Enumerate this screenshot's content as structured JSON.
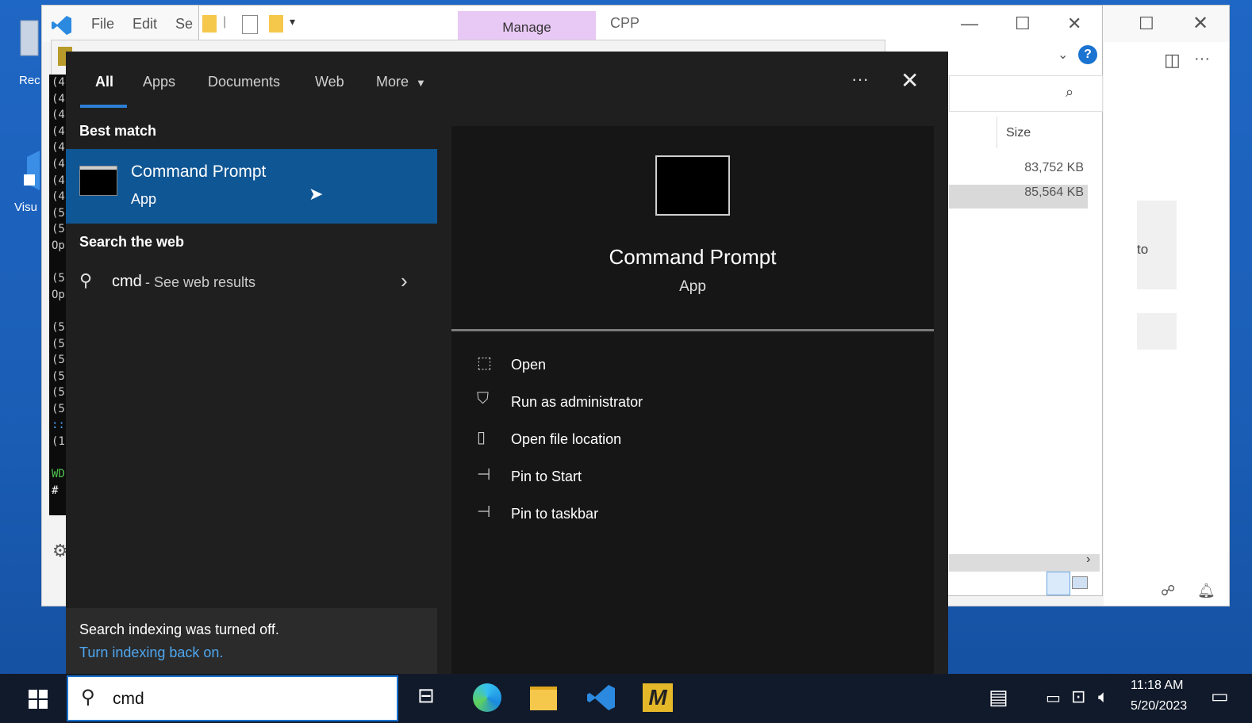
{
  "desktop": {
    "icons": [
      {
        "label": "Rec",
        "icon": "recycle-bin-icon"
      },
      {
        "label": "Visu",
        "icon": "vscode-shortcut-icon"
      }
    ]
  },
  "vscode": {
    "menu": [
      "File",
      "Edit",
      "Se"
    ],
    "right_text": "to"
  },
  "explorer": {
    "tabs": {
      "manage": "Manage",
      "cpp": "CPP"
    },
    "column_header": "Size",
    "sizes": [
      "83,752 KB",
      "85,564 KB"
    ]
  },
  "terminal": {
    "lines": [
      "(4",
      "(4",
      "(4",
      "(4",
      "(4",
      "(4",
      "(4",
      "(4",
      "(5",
      "(5",
      "Op",
      "",
      "(5",
      "Op",
      "",
      "(5",
      "(5",
      "(5",
      "(5",
      "(5",
      "(5",
      "::",
      "(1",
      "",
      "WD",
      "#"
    ]
  },
  "search_panel": {
    "tabs": [
      "All",
      "Apps",
      "Documents",
      "Web",
      "More"
    ],
    "more_menu": "···",
    "best_match_heading": "Best match",
    "best_match": {
      "title": "Command Prompt",
      "subtitle": "App"
    },
    "web_heading": "Search the web",
    "web_result": {
      "query": "cmd",
      "suffix": " - See web results"
    },
    "preview": {
      "title": "Command Prompt",
      "subtitle": "App"
    },
    "actions": [
      "Open",
      "Run as administrator",
      "Open file location",
      "Pin to Start",
      "Pin to taskbar"
    ],
    "footer": {
      "message": "Search indexing was turned off.",
      "link": "Turn indexing back on."
    }
  },
  "taskbar": {
    "search_value": "cmd",
    "time": "11:18 AM",
    "date": "5/20/2023",
    "accent_color": "#1a73d0"
  }
}
